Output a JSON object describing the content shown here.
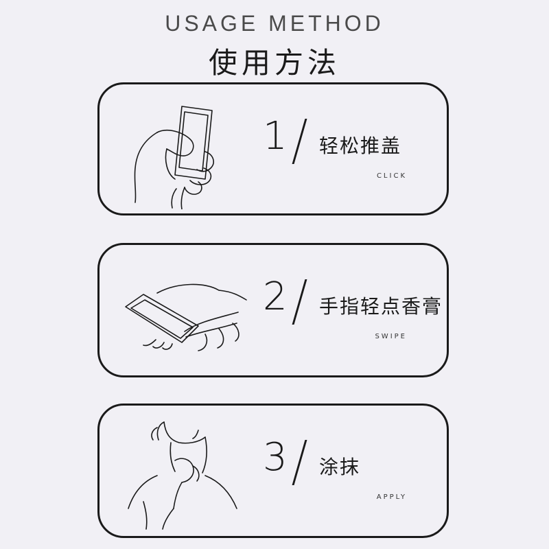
{
  "header": {
    "title_en": "USAGE METHOD",
    "title_zh": "使用方法"
  },
  "steps": [
    {
      "number": "1",
      "label_zh": "轻松推盖",
      "label_en": "CLICK",
      "icon": "hand-push-cap-icon"
    },
    {
      "number": "2",
      "label_zh": "手指轻点香膏",
      "label_en": "SWIPE",
      "icon": "finger-dab-balm-icon"
    },
    {
      "number": "3",
      "label_zh": "涂抹",
      "label_en": "APPLY",
      "icon": "apply-to-neck-icon"
    }
  ]
}
